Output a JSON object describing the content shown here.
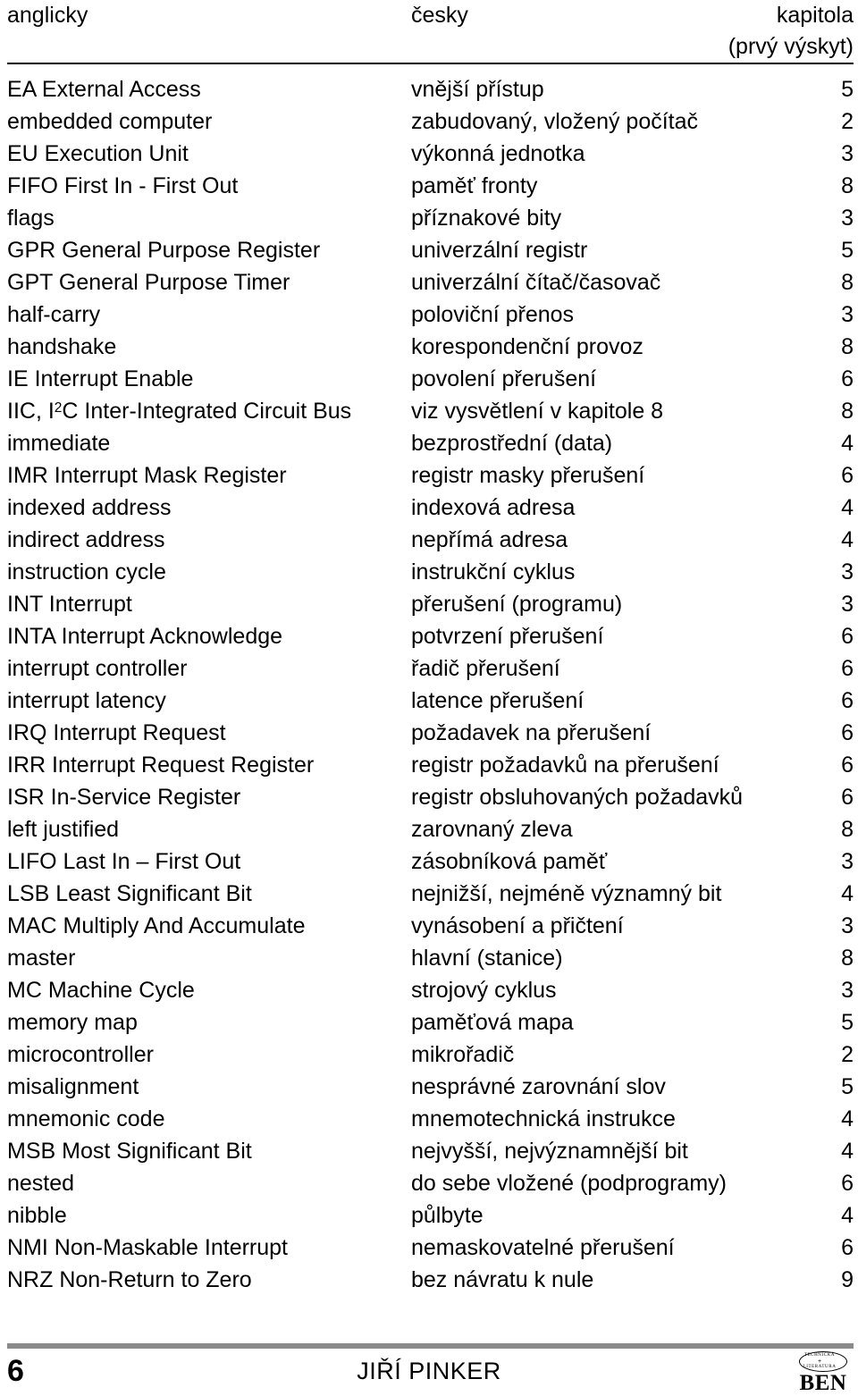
{
  "header": {
    "col_english": "anglicky",
    "col_czech": "česky",
    "col_chapter": "kapitola",
    "col_chapter_sub": "(prvý výskyt)"
  },
  "entries": [
    {
      "english": "EA External Access",
      "czech": "vnější přístup",
      "chapter": "5"
    },
    {
      "english": "embedded computer",
      "czech": "zabudovaný, vložený počítač",
      "chapter": "2"
    },
    {
      "english": "EU Execution Unit",
      "czech": "výkonná jednotka",
      "chapter": "3"
    },
    {
      "english": "FIFO First In - First Out",
      "czech": "paměť fronty",
      "chapter": "8"
    },
    {
      "english": "flags",
      "czech": "příznakové bity",
      "chapter": "3"
    },
    {
      "english": "GPR General Purpose Register",
      "czech": "univerzální registr",
      "chapter": "5"
    },
    {
      "english": "GPT General Purpose Timer",
      "czech": "univerzální čítač/časovač",
      "chapter": "8"
    },
    {
      "english": "half-carry",
      "czech": "poloviční přenos",
      "chapter": "3"
    },
    {
      "english": "handshake",
      "czech": "korespondenční provoz",
      "chapter": "8"
    },
    {
      "english": "IE Interrupt Enable",
      "czech": "povolení přerušení",
      "chapter": "6"
    },
    {
      "english": "IIC, I²C Inter-Integrated Circuit Bus",
      "english_html": "IIC, I<sup>2</sup>C Inter-Integrated Circuit Bus",
      "czech": "viz vysvětlení v kapitole 8",
      "chapter": "8"
    },
    {
      "english": "immediate",
      "czech": "bezprostřední (data)",
      "chapter": "4"
    },
    {
      "english": "IMR Interrupt Mask Register",
      "czech": "registr masky přerušení",
      "chapter": "6"
    },
    {
      "english": "indexed address",
      "czech": "indexová adresa",
      "chapter": "4"
    },
    {
      "english": "indirect address",
      "czech": "nepřímá adresa",
      "chapter": "4"
    },
    {
      "english": "instruction cycle",
      "czech": "instrukční cyklus",
      "chapter": "3"
    },
    {
      "english": "INT Interrupt",
      "czech": "přerušení (programu)",
      "chapter": "3"
    },
    {
      "english": "INTA Interrupt Acknowledge",
      "czech": "potvrzení přerušení",
      "chapter": "6"
    },
    {
      "english": "interrupt  controller",
      "czech": "řadič přerušení",
      "chapter": "6"
    },
    {
      "english": "interrupt latency",
      "czech": "latence přerušení",
      "chapter": "6"
    },
    {
      "english": "IRQ Interrupt Request",
      "czech": "požadavek na přerušení",
      "chapter": "6"
    },
    {
      "english": "IRR Interrupt Request Register",
      "czech": "registr požadavků na přerušení",
      "chapter": "6"
    },
    {
      "english": "ISR In-Service Register",
      "czech": "registr obsluhovaných požadavků",
      "chapter": "6"
    },
    {
      "english": "left justified",
      "czech": "zarovnaný zleva",
      "chapter": "8"
    },
    {
      "english": "LIFO Last In – First Out",
      "czech": "zásobníková paměť",
      "chapter": "3"
    },
    {
      "english": "LSB Least Significant Bit",
      "czech": "nejnižší, nejméně významný bit",
      "chapter": "4"
    },
    {
      "english": "MAC Multiply And Accumulate",
      "czech": "vynásobení a přičtení",
      "chapter": "3"
    },
    {
      "english": "master",
      "czech": "hlavní (stanice)",
      "chapter": "8"
    },
    {
      "english": "MC Machine Cycle",
      "czech": "strojový cyklus",
      "chapter": "3"
    },
    {
      "english": "memory map",
      "czech": "paměťová mapa",
      "chapter": "5"
    },
    {
      "english": "microcontroller",
      "czech": "mikrořadič",
      "chapter": "2"
    },
    {
      "english": "misalignment",
      "czech": "nesprávné zarovnání slov",
      "chapter": "5"
    },
    {
      "english": "mnemonic code",
      "czech": "mnemotechnická instrukce",
      "chapter": "4"
    },
    {
      "english": "MSB Most Significant Bit",
      "czech": "nejvyšší, nejvýznamnější bit",
      "chapter": "4"
    },
    {
      "english": "nested",
      "czech": "do sebe vložené (podprogramy)",
      "chapter": "6"
    },
    {
      "english": "nibble",
      "czech": "půlbyte",
      "chapter": "4"
    },
    {
      "english": "NMI Non-Maskable Interrupt",
      "czech": "nemaskovatelné přerušení",
      "chapter": "6"
    },
    {
      "english": "NRZ Non-Return to Zero",
      "czech": "bez návratu k nule",
      "chapter": "9"
    }
  ],
  "footer": {
    "page_number": "6",
    "author": "JIŘÍ PINKER",
    "publisher": {
      "name": "BEN",
      "oval_top": "TECHNICKÁ",
      "oval_middle": "+",
      "oval_bottom": "LITERATURA"
    }
  },
  "colors": {
    "text": "#000000",
    "header_rule": "#000000",
    "footer_rule": "#8a8a8a",
    "background": "#ffffff"
  }
}
